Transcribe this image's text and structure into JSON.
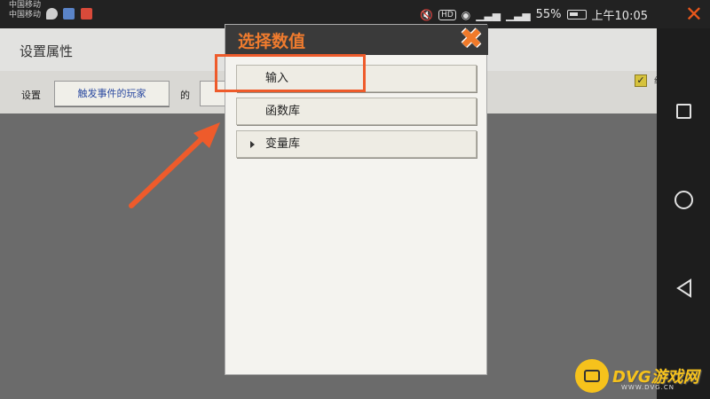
{
  "status_bar": {
    "carrier_top": "中国移动",
    "carrier_bottom": "中国移动",
    "hd_badge": "HD",
    "battery": "55%",
    "time": "上午10:05"
  },
  "app": {
    "title": "设置属性",
    "row_label": "设置",
    "event_button": "触发事件的玩家",
    "of_label": "的",
    "checkbox_label": "组件开关"
  },
  "dialog": {
    "title": "选择数值",
    "options": [
      {
        "label": "输入"
      },
      {
        "label": "函数库"
      },
      {
        "label": "变量库"
      }
    ]
  },
  "watermark": {
    "name": "DVG游戏网",
    "url": "WWW.DVG.CN"
  },
  "colors": {
    "accent": "#ef7b2e",
    "highlight": "#ee5b2b",
    "watermark": "#f6c21c"
  }
}
